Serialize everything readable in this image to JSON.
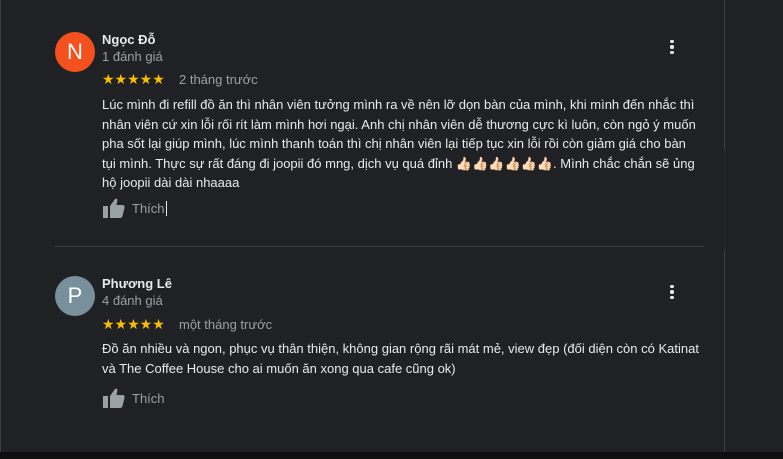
{
  "reviews": [
    {
      "avatar_letter": "N",
      "avatar_color": "#f4511e",
      "name": "Ngọc Đỗ",
      "review_count": "1 đánh giá",
      "stars": "★★★★★",
      "rating": 5,
      "time": "2 tháng trước",
      "text": "Lúc mình đi refill đồ ăn thì nhân viên tưởng mình ra về nên lỡ dọn bàn của mình, khi mình đến nhắc thì nhân viên cứ xin lỗi rối rít làm mình hơi ngại. Anh chị nhân viên dễ thương cực kì luôn, còn ngỏ ý muốn pha sốt lại giúp mình, lúc mình thanh toán thì chị nhân viên lại tiếp tục xin lỗi rồi còn giảm giá cho bàn tụi mình. Thực sự rất đáng đi joopii đó mng, dịch vụ quá đỉnh 👍🏻👍🏻👍🏻👍🏻👍🏻👍🏻. Mình chắc chắn sẽ ủng hộ joopii dài dài nhaaaa",
      "like_label": "Thích"
    },
    {
      "avatar_letter": "P",
      "avatar_color": "#78909c",
      "name": "Phương Lê",
      "review_count": "4 đánh giá",
      "stars": "★★★★★",
      "rating": 5,
      "time": "một tháng trước",
      "text": "Đồ ăn nhiều và ngon, phục vụ thân thiện, không gian rộng rãi mát mẻ, view đẹp (đối diện còn có Katinat và The Coffee House cho ai muốn ăn xong qua cafe cũng ok)",
      "like_label": "Thích"
    }
  ],
  "colors": {
    "background": "#202124",
    "star": "#fbbc04",
    "text": "#e8eaed",
    "muted": "#9aa0a6",
    "divider": "#3c4043"
  },
  "icons": {
    "like": "thumb-up-icon",
    "menu": "more-vert-icon"
  }
}
